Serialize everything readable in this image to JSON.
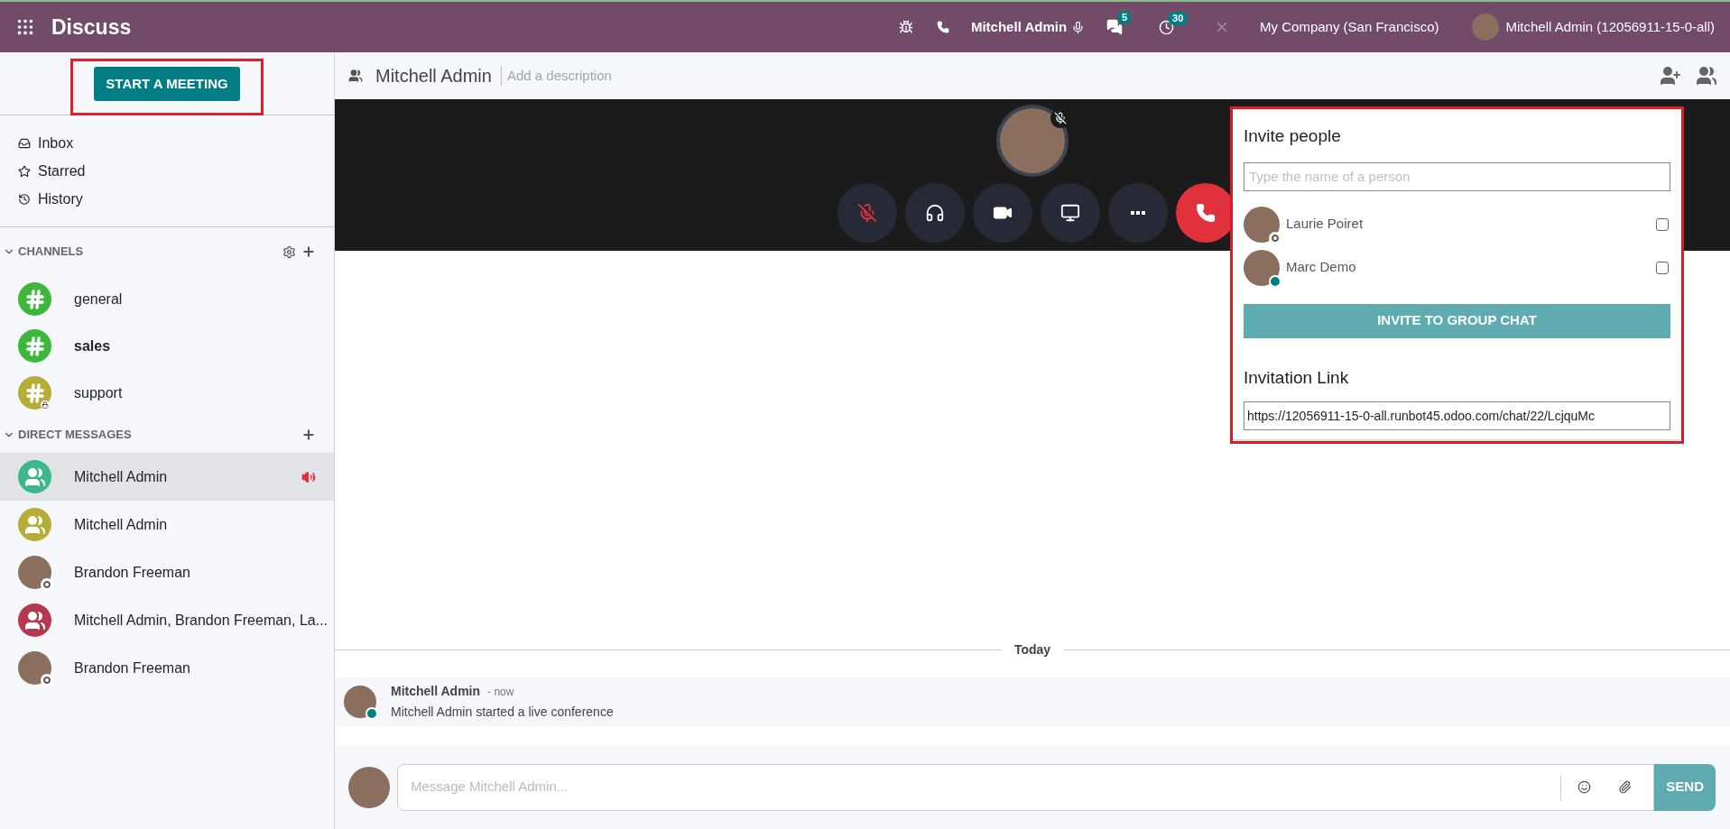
{
  "topbar": {
    "app_title": "Discuss",
    "user_status": "Mitchell Admin",
    "chat_badge": "5",
    "activity_badge": "30",
    "company": "My Company (San Francisco)",
    "user": "Mitchell Admin (12056911-15-0-all)"
  },
  "sidebar": {
    "start_button": "START A MEETING",
    "mailboxes": [
      {
        "kind": "inbox",
        "label": "Inbox"
      },
      {
        "kind": "starred",
        "label": "Starred"
      },
      {
        "kind": "history",
        "label": "History"
      }
    ],
    "channels_heading": "CHANNELS",
    "channels": [
      {
        "name": "general",
        "color": "#3cb73c",
        "unread": false,
        "private": false
      },
      {
        "name": "sales",
        "color": "#3cb73c",
        "unread": true,
        "private": false
      },
      {
        "name": "support",
        "color": "#b5ad38",
        "unread": false,
        "private": true
      }
    ],
    "dm_heading": "DIRECT MESSAGES",
    "direct_messages": [
      {
        "kind": "group",
        "name": "Mitchell Admin",
        "color": "#3cb78e",
        "selected": true,
        "in_call": true
      },
      {
        "kind": "group",
        "name": "Mitchell Admin",
        "color": "#b5ad38",
        "selected": false,
        "in_call": false
      },
      {
        "kind": "person",
        "name": "Brandon Freeman",
        "online": false,
        "selected": false,
        "in_call": false
      },
      {
        "kind": "group",
        "name": "Mitchell Admin, Brandon Freeman, La...",
        "color": "#b5384f",
        "selected": false,
        "in_call": false
      },
      {
        "kind": "person",
        "name": "Brandon Freeman",
        "online": false,
        "selected": false,
        "in_call": false
      }
    ]
  },
  "thread": {
    "title": "Mitchell Admin",
    "description_placeholder": "Add a description",
    "call_controls": [
      {
        "kind": "mute"
      },
      {
        "kind": "deafen"
      },
      {
        "kind": "camera"
      },
      {
        "kind": "screen"
      },
      {
        "kind": "more"
      },
      {
        "kind": "hangup"
      }
    ],
    "invite": {
      "title": "Invite people",
      "search_placeholder": "Type the name of a person",
      "people": [
        {
          "name": "Laurie Poiret",
          "online": false,
          "checked": false
        },
        {
          "name": "Marc Demo",
          "online": true,
          "checked": false
        }
      ],
      "invite_button": "INVITE TO GROUP CHAT",
      "link_title": "Invitation Link",
      "link": "https://12056911-15-0-all.runbot45.odoo.com/chat/22/LcjquMc"
    },
    "date_separator": "Today",
    "messages": [
      {
        "author": "Mitchell Admin",
        "time": "- now",
        "body": "Mitchell Admin started a live conference",
        "online": true
      }
    ],
    "composer": {
      "placeholder": "Message Mitchell Admin...",
      "send": "SEND"
    }
  }
}
